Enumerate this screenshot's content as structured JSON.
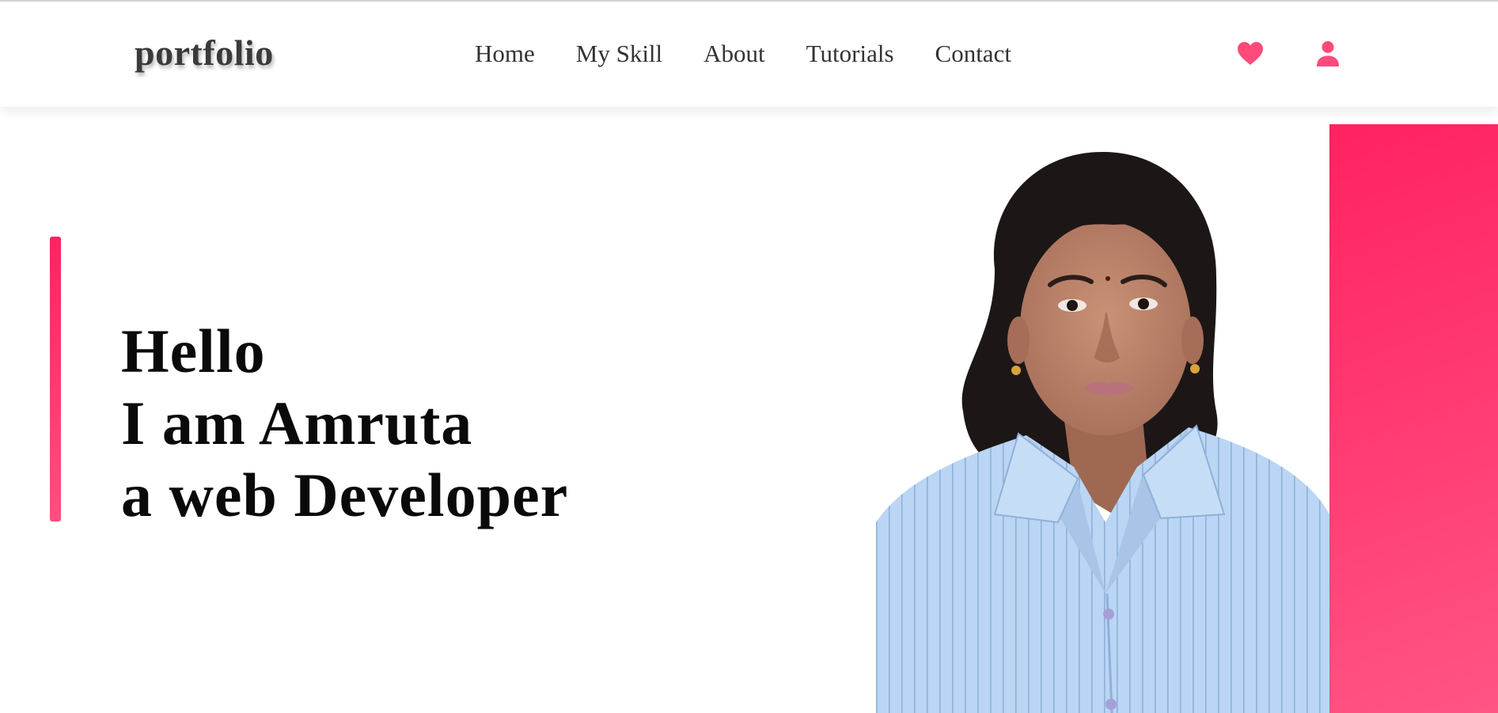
{
  "header": {
    "logo": "portfolio",
    "nav": [
      {
        "label": "Home"
      },
      {
        "label": "My Skill"
      },
      {
        "label": "About"
      },
      {
        "label": "Tutorials"
      },
      {
        "label": "Contact"
      }
    ],
    "icons": {
      "favorite": "heart-icon",
      "account": "user-icon"
    }
  },
  "hero": {
    "line1": "Hello",
    "line2": "I am Amruta",
    "line3": "a web Developer"
  },
  "colors": {
    "accent": "#ff2d67",
    "accent_light": "#ff5584",
    "text_dark": "#0a0a0a",
    "nav_text": "#333333",
    "shirt": "#b9d6f5"
  }
}
